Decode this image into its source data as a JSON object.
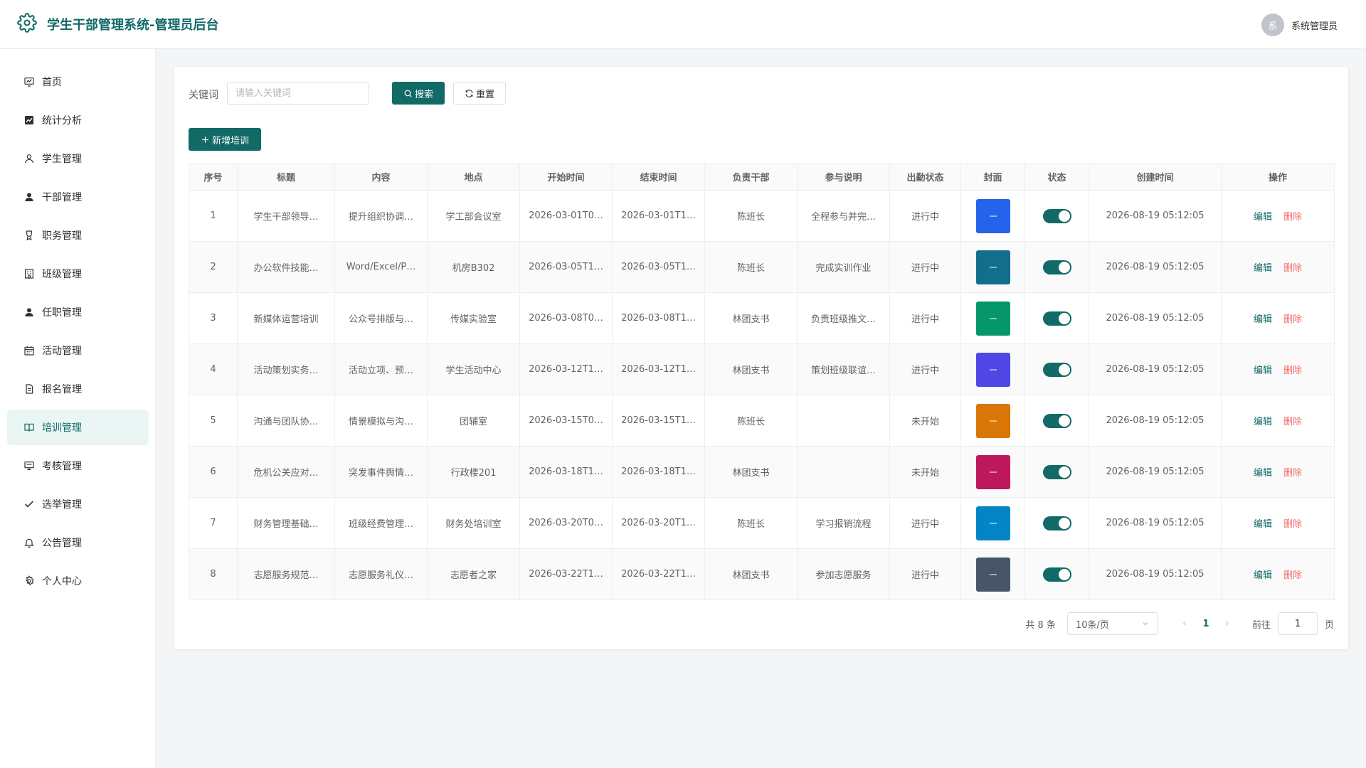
{
  "header": {
    "title": "学生干部管理系统-管理员后台",
    "avatar_text": "系",
    "user_name": "系统管理员"
  },
  "sidebar": {
    "items": [
      {
        "label": "首页",
        "icon": "dashboard-icon"
      },
      {
        "label": "统计分析",
        "icon": "chart-icon"
      },
      {
        "label": "学生管理",
        "icon": "user-icon"
      },
      {
        "label": "干部管理",
        "icon": "user-filled-icon"
      },
      {
        "label": "职务管理",
        "icon": "medal-icon"
      },
      {
        "label": "班级管理",
        "icon": "building-icon"
      },
      {
        "label": "任职管理",
        "icon": "user-filled-icon"
      },
      {
        "label": "活动管理",
        "icon": "calendar-icon"
      },
      {
        "label": "报名管理",
        "icon": "document-icon"
      },
      {
        "label": "培训管理",
        "icon": "book-icon",
        "active": true
      },
      {
        "label": "考核管理",
        "icon": "trophy-icon"
      },
      {
        "label": "选举管理",
        "icon": "check-icon"
      },
      {
        "label": "公告管理",
        "icon": "bell-icon"
      },
      {
        "label": "个人中心",
        "icon": "gear-icon"
      }
    ]
  },
  "search": {
    "label": "关键词",
    "placeholder": "请输入关键词",
    "value": "",
    "search_btn": "搜索",
    "reset_btn": "重置"
  },
  "toolbar": {
    "add_btn": "新增培训"
  },
  "table": {
    "columns": [
      "序号",
      "标题",
      "内容",
      "地点",
      "开始时间",
      "结束时间",
      "负责干部",
      "参与说明",
      "出勤状态",
      "封面",
      "状态",
      "创建时间",
      "操作"
    ],
    "edit_label": "编辑",
    "delete_label": "删除",
    "rows": [
      {
        "no": "1",
        "title": "学生干部领导…",
        "content": "提升组织协调…",
        "place": "学工部会议室",
        "start": "2026-03-01T0…",
        "end": "2026-03-01T1…",
        "leader": "陈班长",
        "note": "全程参与并完…",
        "attendance": "进行中",
        "cover_color": "#2463eb",
        "enabled": true,
        "created": "2026-08-19 05:12:05"
      },
      {
        "no": "2",
        "title": "办公软件技能…",
        "content": "Word/Excel/P…",
        "place": "机房B302",
        "start": "2026-03-05T1…",
        "end": "2026-03-05T1…",
        "leader": "陈班长",
        "note": "完成实训作业",
        "attendance": "进行中",
        "cover_color": "#116f8c",
        "enabled": true,
        "created": "2026-08-19 05:12:05"
      },
      {
        "no": "3",
        "title": "新媒体运营培训",
        "content": "公众号排版与…",
        "place": "传媒实验室",
        "start": "2026-03-08T0…",
        "end": "2026-03-08T1…",
        "leader": "林团支书",
        "note": "负责班级推文…",
        "attendance": "进行中",
        "cover_color": "#059669",
        "enabled": true,
        "created": "2026-08-19 05:12:05"
      },
      {
        "no": "4",
        "title": "活动策划实务…",
        "content": "活动立项、预…",
        "place": "学生活动中心",
        "start": "2026-03-12T1…",
        "end": "2026-03-12T1…",
        "leader": "林团支书",
        "note": "策划班级联谊…",
        "attendance": "进行中",
        "cover_color": "#4f46e5",
        "enabled": true,
        "created": "2026-08-19 05:12:05"
      },
      {
        "no": "5",
        "title": "沟通与团队协…",
        "content": "情景模拟与沟…",
        "place": "团辅室",
        "start": "2026-03-15T0…",
        "end": "2026-03-15T1…",
        "leader": "陈班长",
        "note": "",
        "attendance": "未开始",
        "cover_color": "#d97706",
        "enabled": true,
        "created": "2026-08-19 05:12:05"
      },
      {
        "no": "6",
        "title": "危机公关应对…",
        "content": "突发事件舆情…",
        "place": "行政楼201",
        "start": "2026-03-18T1…",
        "end": "2026-03-18T1…",
        "leader": "林团支书",
        "note": "",
        "attendance": "未开始",
        "cover_color": "#be185d",
        "enabled": true,
        "created": "2026-08-19 05:12:05"
      },
      {
        "no": "7",
        "title": "财务管理基础…",
        "content": "班级经费管理…",
        "place": "财务处培训室",
        "start": "2026-03-20T0…",
        "end": "2026-03-20T1…",
        "leader": "陈班长",
        "note": "学习报销流程",
        "attendance": "进行中",
        "cover_color": "#0284c7",
        "enabled": true,
        "created": "2026-08-19 05:12:05"
      },
      {
        "no": "8",
        "title": "志愿服务规范…",
        "content": "志愿服务礼仪…",
        "place": "志愿者之家",
        "start": "2026-03-22T1…",
        "end": "2026-03-22T1…",
        "leader": "林团支书",
        "note": "参加志愿服务",
        "attendance": "进行中",
        "cover_color": "#475569",
        "enabled": true,
        "created": "2026-08-19 05:12:05"
      }
    ]
  },
  "pagination": {
    "total_text": "共 8 条",
    "page_size": "10条/页",
    "current_page": "1",
    "goto_label": "前往",
    "goto_value": "1",
    "page_suffix": "页"
  }
}
